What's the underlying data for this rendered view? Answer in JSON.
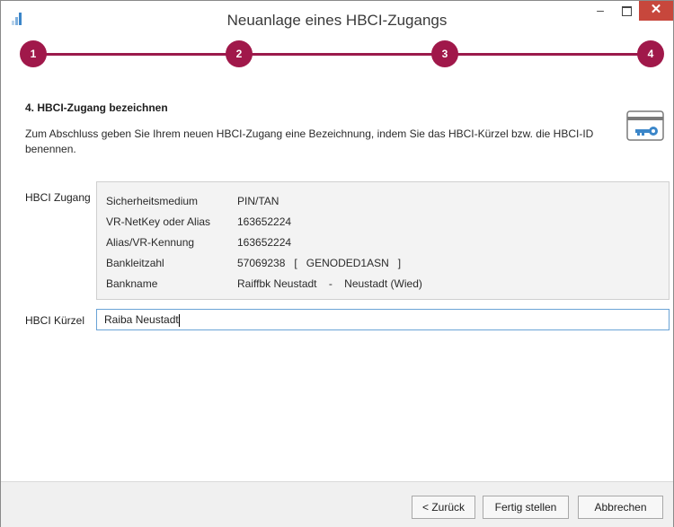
{
  "window": {
    "title": "Neuanlage eines HBCI-Zugangs",
    "icons": {
      "app": "bar-chart-icon",
      "minimize": "minimize-icon",
      "maximize": "maximize-icon",
      "close": "close-icon",
      "card": "key-card-icon"
    },
    "minimize_glyph": "–",
    "close_glyph": "✕"
  },
  "colors": {
    "accent": "#a0184a",
    "close": "#c7473c",
    "input_border": "#6aa3d6"
  },
  "stepper": {
    "steps": [
      "1",
      "2",
      "3",
      "4"
    ],
    "current": 4
  },
  "section": {
    "heading": "4. HBCI-Zugang bezeichnen",
    "description": "Zum Abschluss geben Sie Ihrem neuen HBCI-Zugang eine Bezeichnung, indem Sie das HBCI-Kürzel bzw. die HBCI-ID benennen."
  },
  "zugang": {
    "label": "HBCI Zugang",
    "rows": [
      {
        "key": "Sicherheitsmedium",
        "value": "PIN/TAN"
      },
      {
        "key": "VR-NetKey oder Alias",
        "value": "163652224"
      },
      {
        "key": "Alias/VR-Kennung",
        "value": "163652224"
      },
      {
        "key": "Bankleitzahl",
        "value": "57069238   [   GENODED1ASN   ]"
      },
      {
        "key": "Bankname",
        "value": "Raiffbk Neustadt    -    Neustadt (Wied)"
      }
    ]
  },
  "kuerzel": {
    "label": "HBCI Kürzel",
    "value": "Raiba Neustadt"
  },
  "buttons": {
    "back": "< Zurück",
    "finish": "Fertig stellen",
    "cancel": "Abbrechen"
  }
}
